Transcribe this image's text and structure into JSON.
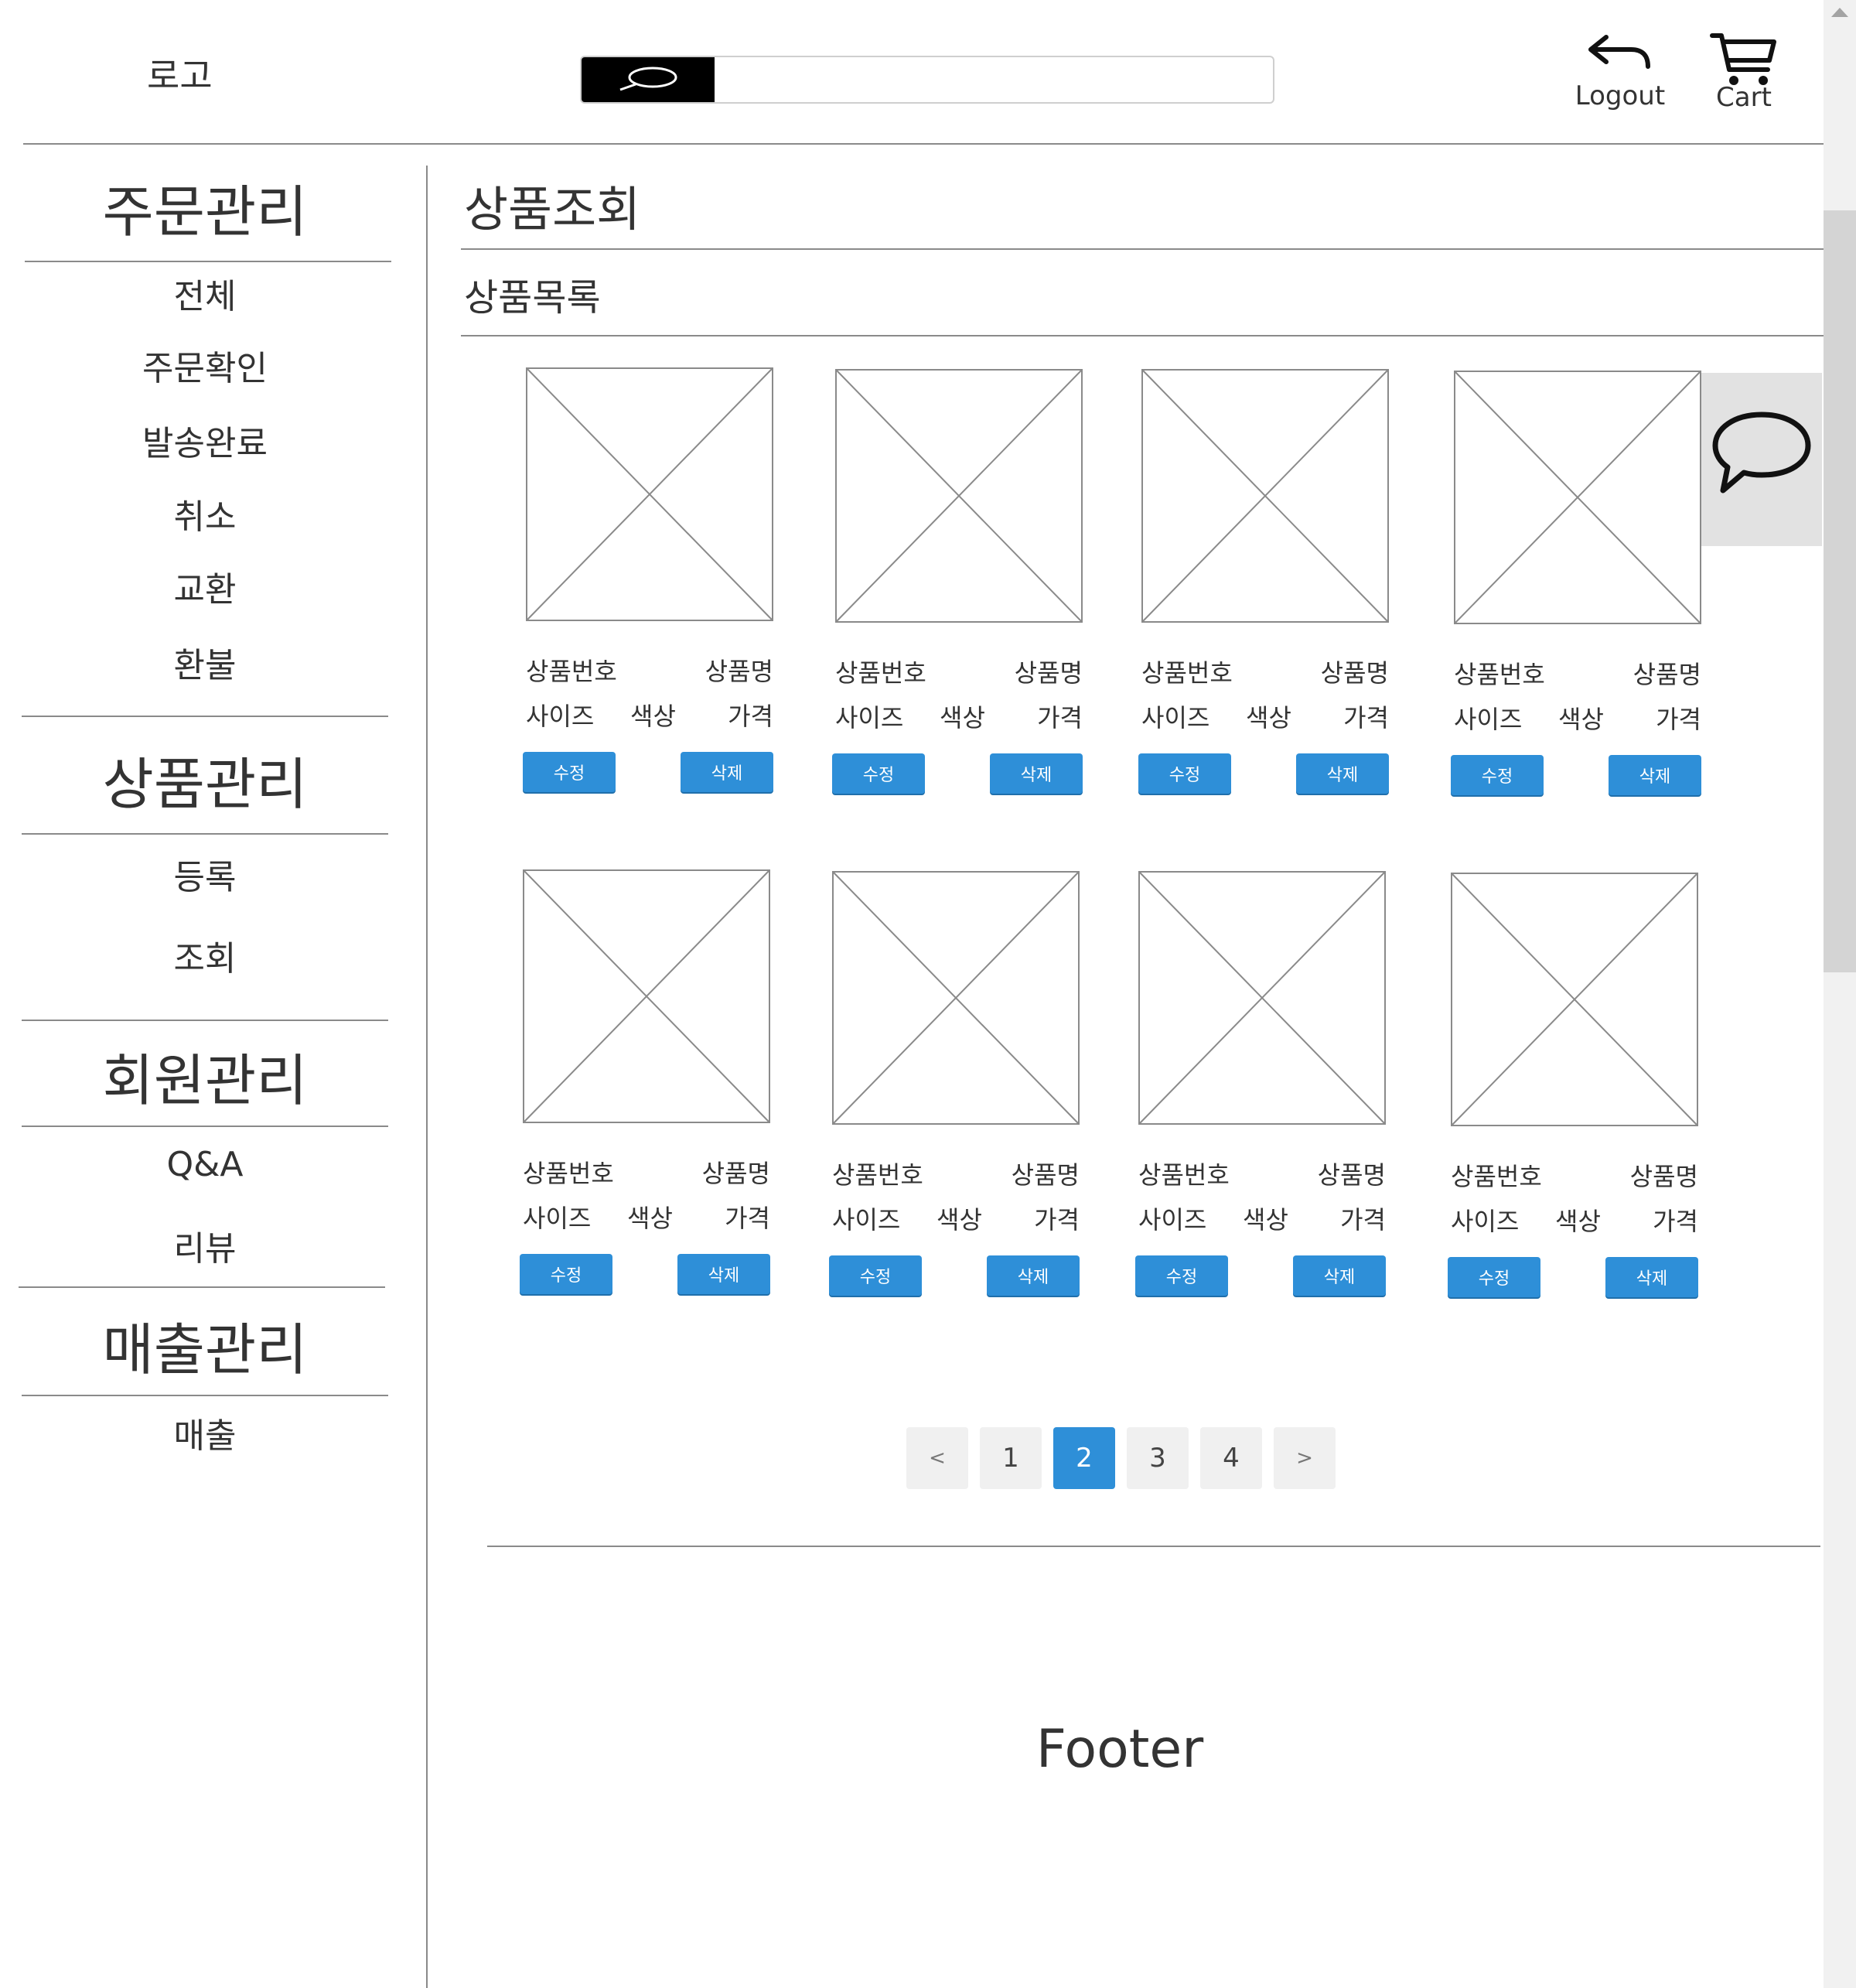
{
  "header": {
    "logo": "로고",
    "search_placeholder": "",
    "logout_label": "Logout",
    "cart_label": "Cart"
  },
  "sidebar": {
    "sections": [
      {
        "title": "주문관리",
        "items": [
          "전체",
          "주문확인",
          "발송완료",
          "취소",
          "교환",
          "환불"
        ]
      },
      {
        "title": "상품관리",
        "items": [
          "등록",
          "조회"
        ]
      },
      {
        "title": "회원관리",
        "items": [
          "Q&A",
          "리뷰"
        ]
      },
      {
        "title": "매출관리",
        "items": [
          "매출"
        ]
      }
    ]
  },
  "main": {
    "page_title": "상품조회",
    "section_title": "상품목록",
    "card": {
      "product_no": "상품번호",
      "product_name": "상품명",
      "size": "사이즈",
      "color": "색상",
      "price": "가격",
      "edit_label": "수정",
      "delete_label": "삭제"
    },
    "product_count": 8
  },
  "pagination": {
    "prev": "<",
    "pages": [
      "1",
      "2",
      "3",
      "4"
    ],
    "current": "2",
    "next": ">"
  },
  "footer": {
    "text": "Footer"
  },
  "colors": {
    "accent": "#2e8fd8",
    "line": "#8a8a8a",
    "chat_tab": "#e2e2e2"
  }
}
